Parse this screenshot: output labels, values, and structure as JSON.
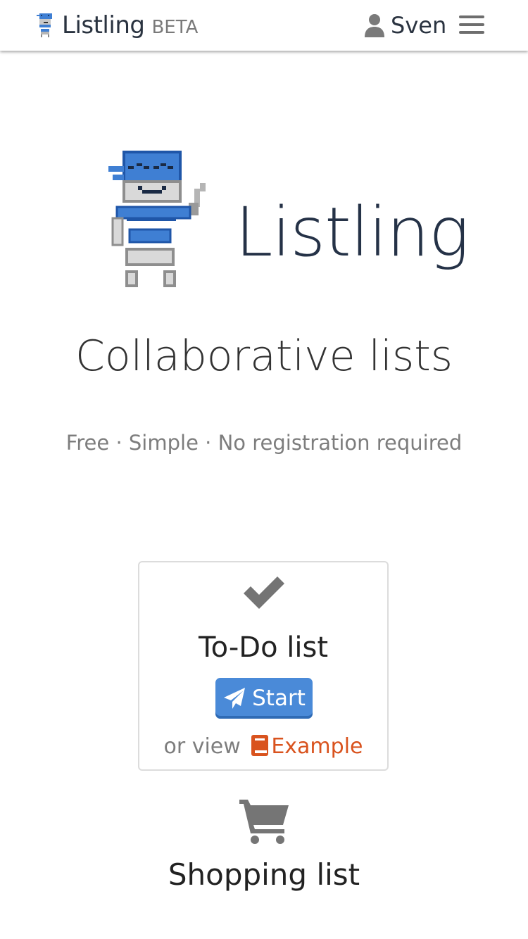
{
  "header": {
    "brand_name": "Listling",
    "brand_badge": "BETA",
    "user_name": "Sven",
    "icons": {
      "logo": "robot-logo-icon",
      "user": "user-icon",
      "menu": "hamburger-menu-icon"
    }
  },
  "hero": {
    "title": "Listling",
    "tagline": "Collaborative lists",
    "features": "Free · Simple · No registration required"
  },
  "cards": {
    "todo": {
      "icon": "checkmark-icon",
      "title": "To-Do list",
      "start_label": "Start",
      "or_view": "or view",
      "example_label": "Example"
    },
    "shopping": {
      "icon": "cart-icon",
      "title": "Shopping list"
    }
  },
  "colors": {
    "accent_blue": "#4a8ad8",
    "example_orange": "#d9531e",
    "robot_blue": "#3f7fd3",
    "text_dark": "#253247",
    "text_muted": "#7d7d7d"
  }
}
